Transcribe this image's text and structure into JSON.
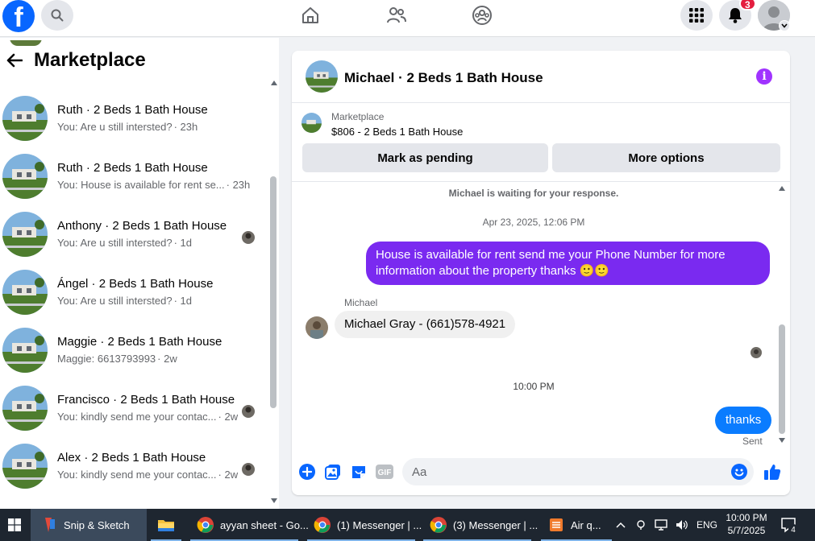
{
  "topbar": {
    "logo": "f",
    "notification_count": "3",
    "colors": {
      "brand": "#0866ff",
      "badge": "#e41e3f"
    }
  },
  "sidebar": {
    "title": "Marketplace",
    "conversations": [
      {
        "title": "Ruth · 2 Beds 1 Bath House",
        "preview": "You: Are u still intersted?",
        "time": "· 23h",
        "seen": false
      },
      {
        "title": "Ruth · 2 Beds 1 Bath House",
        "preview": "You: House is available for rent se...",
        "time": "· 23h",
        "seen": false
      },
      {
        "title": "Anthony · 2 Beds 1 Bath House",
        "preview": "You: Are u still intersted?",
        "time": "· 1d",
        "seen": true
      },
      {
        "title": "Ángel · 2 Beds 1 Bath House",
        "preview": "You: Are u still intersted?",
        "time": "· 1d",
        "seen": false
      },
      {
        "title": "Maggie · 2 Beds 1 Bath House",
        "preview": "Maggie: 6613793993",
        "time": "· 2w",
        "seen": false
      },
      {
        "title": "Francisco · 2 Beds 1 Bath House",
        "preview": "You: kindly send me your contac...",
        "time": "· 2w",
        "seen": true
      },
      {
        "title": "Alex · 2 Beds 1 Bath House",
        "preview": "You: kindly send me your contac...",
        "time": "· 2w",
        "seen": true
      }
    ]
  },
  "chat": {
    "title": "Michael · 2 Beds 1 Bath House",
    "marketplace_label": "Marketplace",
    "listing": "$806 - 2 Beds 1 Bath House",
    "mark_pending": "Mark as pending",
    "more_options": "More options",
    "waiting_note": "Michael is waiting for your response.",
    "date_1": "Apr 23, 2025, 12:06 PM",
    "outgoing_1": "House is available for rent send me your Phone Number for more information about the property thanks 🙂🙂",
    "sender_name": "Michael",
    "incoming_1": "Michael Gray - (661)578-4921",
    "date_2": "10:00 PM",
    "outgoing_2": "thanks",
    "status": "Sent",
    "input_placeholder": "Aa",
    "colors": {
      "purple_bubble": "#7a2af0",
      "blue_bubble": "#0a7cff",
      "info": "#a033ff"
    }
  },
  "taskbar": {
    "items": [
      {
        "label": "Snip & Sketch",
        "icon": "snip-sketch-icon",
        "active": true
      },
      {
        "label": "",
        "icon": "file-explorer-icon",
        "active": false
      },
      {
        "label": "ayyan sheet - Go...",
        "icon": "chrome-icon",
        "active": false
      },
      {
        "label": "(1) Messenger | ...",
        "icon": "chrome-icon",
        "active": false
      },
      {
        "label": "(3) Messenger | ...",
        "icon": "chrome-icon",
        "active": false
      },
      {
        "label": "Air q...",
        "icon": "air-quality-icon",
        "active": false
      }
    ],
    "language": "ENG",
    "time": "10:00 PM",
    "date": "5/7/2025",
    "notifications": "4"
  }
}
